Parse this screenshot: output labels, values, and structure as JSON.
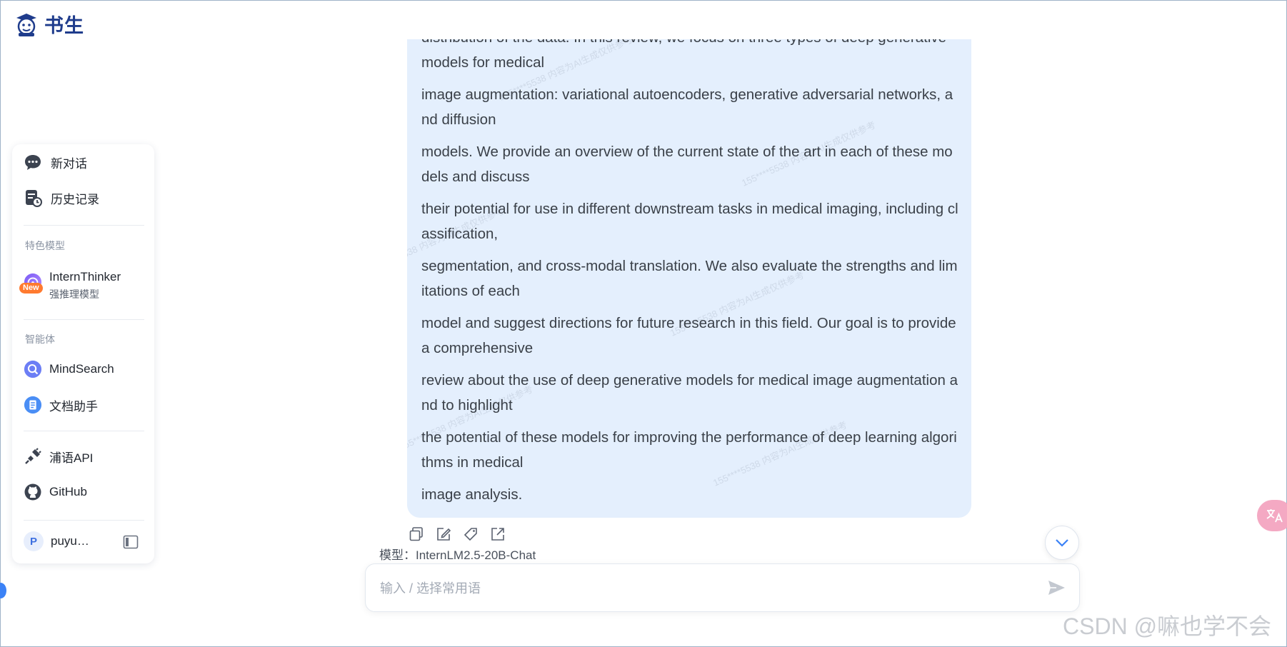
{
  "brand": {
    "name": "书生"
  },
  "sidebar": {
    "new_chat": "新对话",
    "history": "历史记录",
    "featured_caption": "特色模型",
    "thinker": {
      "title": "InternThinker",
      "subtitle": "强推理模型",
      "badge": "New"
    },
    "agents_caption": "智能体",
    "mindsearch": "MindSearch",
    "doc_assistant": "文档助手",
    "api": "浦语API",
    "github": "GitHub",
    "user": {
      "initial": "P",
      "name": "puyu…"
    }
  },
  "message": {
    "paragraphs": [
      "distribution of the data. In this review, we focus on three types of deep generative models for medical",
      "image augmentation: variational autoencoders, generative adversarial networks, and diffusion",
      "models. We provide an overview of the current state of the art in each of these models and discuss",
      "their potential for use in different downstream tasks in medical imaging, including classification,",
      "segmentation, and cross-modal translation. We also evaluate the strengths and limitations of each",
      "model and suggest directions for future research in this field. Our goal is to provide a comprehensive",
      "review about the use of deep generative models for medical image augmentation and to highlight",
      "the potential of these models for improving the performance of deep learning algorithms in medical",
      "image analysis."
    ],
    "watermark": "155****5538 内容为AI生成仅供参考"
  },
  "model": {
    "label": "模型：InternLM2.5-20B-Chat"
  },
  "input": {
    "placeholder": "输入 / 选择常用语"
  },
  "footer": {
    "csdn_watermark": "CSDN @嘛也学不会"
  },
  "colors": {
    "bubble": "#e4effd",
    "brand": "#1f3c8c",
    "accent": "#3b82f6",
    "translate_fab": "#f4a9c3"
  }
}
